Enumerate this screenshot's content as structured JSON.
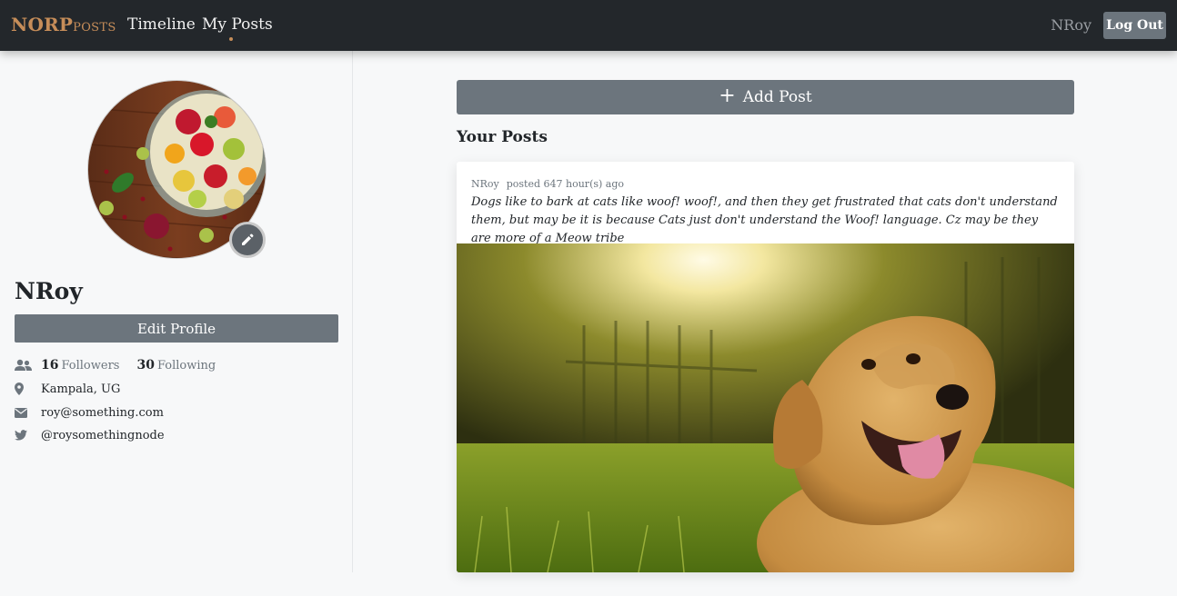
{
  "navbar": {
    "brand_main": "NORP",
    "brand_small": "POSTS",
    "links": [
      "Timeline",
      "My Posts"
    ],
    "active_link": "My Posts",
    "username": "NRoy",
    "logout_label": "Log Out"
  },
  "profile": {
    "name": "NRoy",
    "edit_profile_label": "Edit Profile",
    "followers_count": "16",
    "followers_label": "Followers",
    "following_count": "30",
    "following_label": "Following",
    "location": "Kampala, UG",
    "email": "roy@something.com",
    "twitter": "@roysomethingnode",
    "icons": {
      "followers": "users-icon",
      "location": "map-marker-icon",
      "email": "envelope-icon",
      "twitter": "twitter-icon",
      "edit_avatar": "pencil-icon",
      "add_post": "plus-icon"
    }
  },
  "main": {
    "add_post_label": "Add Post",
    "section_title": "Your Posts",
    "posts": [
      {
        "author": "NRoy",
        "time": "posted 647 hour(s) ago",
        "text": "Dogs like to bark at cats like woof! woof!, and then they get frustrated that cats don't understand them, but may be it is because Cats just don't understand the Woof! language. Cz may be they are more of a Meow tribe"
      }
    ]
  },
  "colors": {
    "navbar_bg": "#23272b",
    "brand": "#c68d59",
    "button_gray": "#6c757d",
    "page_bg": "#f7f8f9"
  }
}
